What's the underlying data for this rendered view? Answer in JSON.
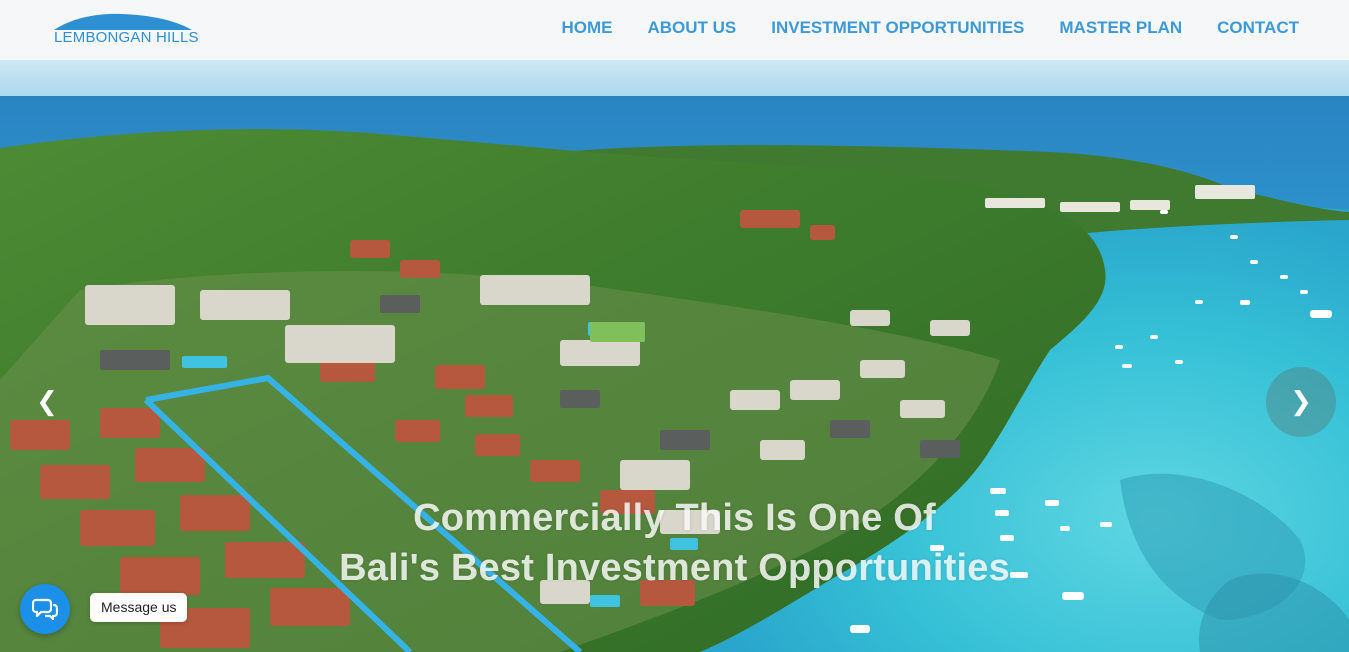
{
  "brand": {
    "logo_text": "LEMBONGAN HILLS",
    "color": "#2e8fd2"
  },
  "nav": {
    "items": [
      {
        "label": "HOME"
      },
      {
        "label": "ABOUT US"
      },
      {
        "label": "INVESTMENT OPPORTUNITIES"
      },
      {
        "label": "MASTER PLAN"
      },
      {
        "label": "CONTACT"
      }
    ],
    "color": "#3d9ad6"
  },
  "hero": {
    "headline_line1": "Commercially This Is One Of",
    "headline_line2": "Bali's Best Investment Opportunities",
    "prev_icon": "chevron-left-icon",
    "next_icon": "chevron-right-icon",
    "image": "aerial-view-of-island-coast-icon"
  },
  "chat": {
    "label": "Message us",
    "icon": "chat-bubbles-icon",
    "color": "#1c8fe8"
  },
  "palette": {
    "sea_deep": "#2c8fc9",
    "lagoon": "#3cc6d8",
    "vegetation": "#3f7a2e",
    "roof": "#b5583e",
    "outline": "#35b3e6"
  }
}
